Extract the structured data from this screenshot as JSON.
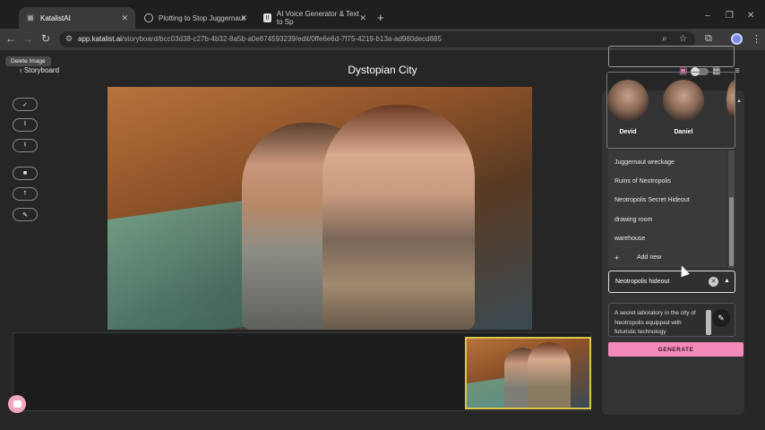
{
  "browser": {
    "tabs": [
      {
        "title": "KatalistAI",
        "favicon": "katalist-icon",
        "active": true
      },
      {
        "title": "Plotting to Stop Juggernaut",
        "favicon": "doc-icon",
        "active": false
      },
      {
        "title": "AI Voice Generator & Text to Sp",
        "favicon": "elevenlabs-icon",
        "active": false
      }
    ],
    "new_tab_label": "+",
    "url_domain": "app.katalist.ai",
    "url_path": "/storyboard/bcc03d38-c27b-4b32-8a5b-a0e874593239/edit/0ffe6e6d-7f75-4219-b13a-ad960decd885",
    "window_controls": [
      "–",
      "❐",
      "✕"
    ]
  },
  "app": {
    "tooltip": "Delete Image",
    "back_label": "‹ Storyboard",
    "title": "Dystopian City",
    "left_tools": [
      {
        "name": "check-tool-button",
        "glyph": "✓"
      },
      {
        "name": "upload-tool-button",
        "glyph": "⭱"
      },
      {
        "name": "download-tool-button",
        "glyph": "⭳"
      },
      {
        "name": "crop-tool-button",
        "glyph": "■"
      },
      {
        "name": "pin-tool-button",
        "glyph": "⭡"
      },
      {
        "name": "brush-tool-button",
        "glyph": "✎"
      }
    ]
  },
  "panel": {
    "characters": [
      {
        "name": "Devid"
      },
      {
        "name": "Daniel"
      }
    ],
    "location_options": [
      "Juggernaut wreckage",
      "Ruins of Neotropolis",
      "Neotropolis Secret Hideout",
      "drawing room",
      "warehouse"
    ],
    "add_new_label": "Add new",
    "add_new_icon": "+",
    "selected_location": "Neotropolis hideout",
    "clear_icon": "✕",
    "caret_icon": "▲",
    "description": "A secret laboratory in the city of Neotropolis equipped with futuristic technology",
    "edit_icon": "✎",
    "generate_label": "GENERATE"
  },
  "colors": {
    "accent": "#f38ab9",
    "thumb_border": "#d8c94d"
  }
}
